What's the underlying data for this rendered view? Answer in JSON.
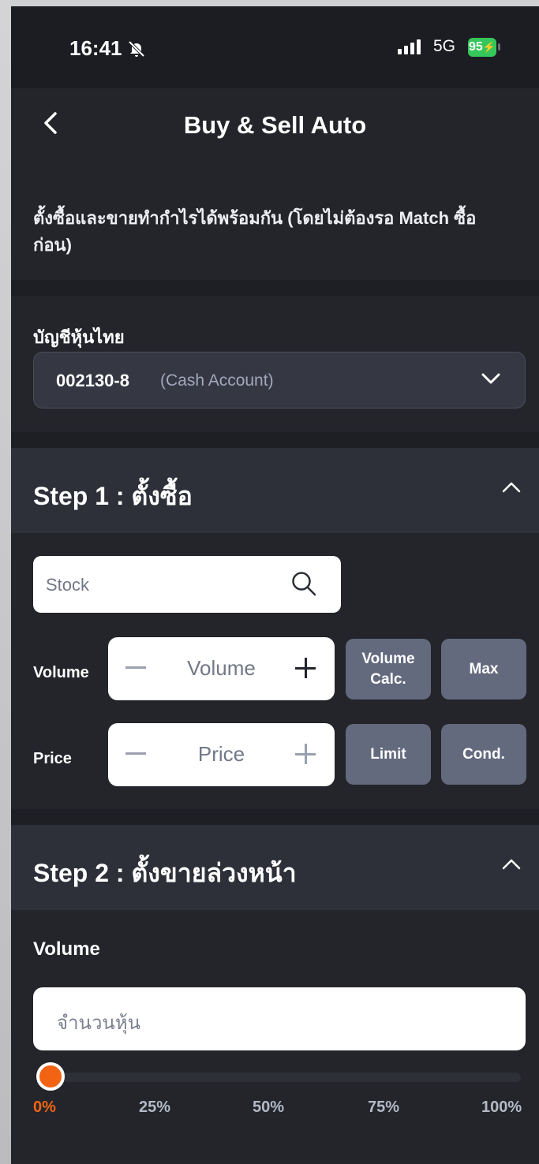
{
  "status_bar": {
    "time": "16:41",
    "network": "5G",
    "battery": "95"
  },
  "header": {
    "title": "Buy & Sell Auto"
  },
  "description": "ตั้งซื้อและขายทำกำไรได้พร้อมกัน (โดยไม่ต้องรอ Match ซื้อก่อน)",
  "account": {
    "label": "บัญชีหุ้นไทย",
    "number": "002130-8",
    "type": "(Cash Account)"
  },
  "step1": {
    "title": "Step 1 : ตั้งซื้อ",
    "stock_placeholder": "Stock",
    "volume_label": "Volume",
    "volume_placeholder": "Volume",
    "volume_calc_line1": "Volume",
    "volume_calc_line2": "Calc.",
    "max_label": "Max",
    "price_label": "Price",
    "price_placeholder": "Price",
    "limit_label": "Limit",
    "cond_label": "Cond."
  },
  "step2": {
    "title": "Step 2 : ตั้งขายล่วงหน้า",
    "volume_label": "Volume",
    "volume_placeholder": "จำนวนหุ้น",
    "slider_value_percent": 0,
    "slider_marks": [
      "0%",
      "25%",
      "50%",
      "75%",
      "100%"
    ]
  },
  "colors": {
    "accent": "#f26414",
    "battery": "#35c759",
    "button": "#636a7e",
    "background": "#23252b"
  }
}
